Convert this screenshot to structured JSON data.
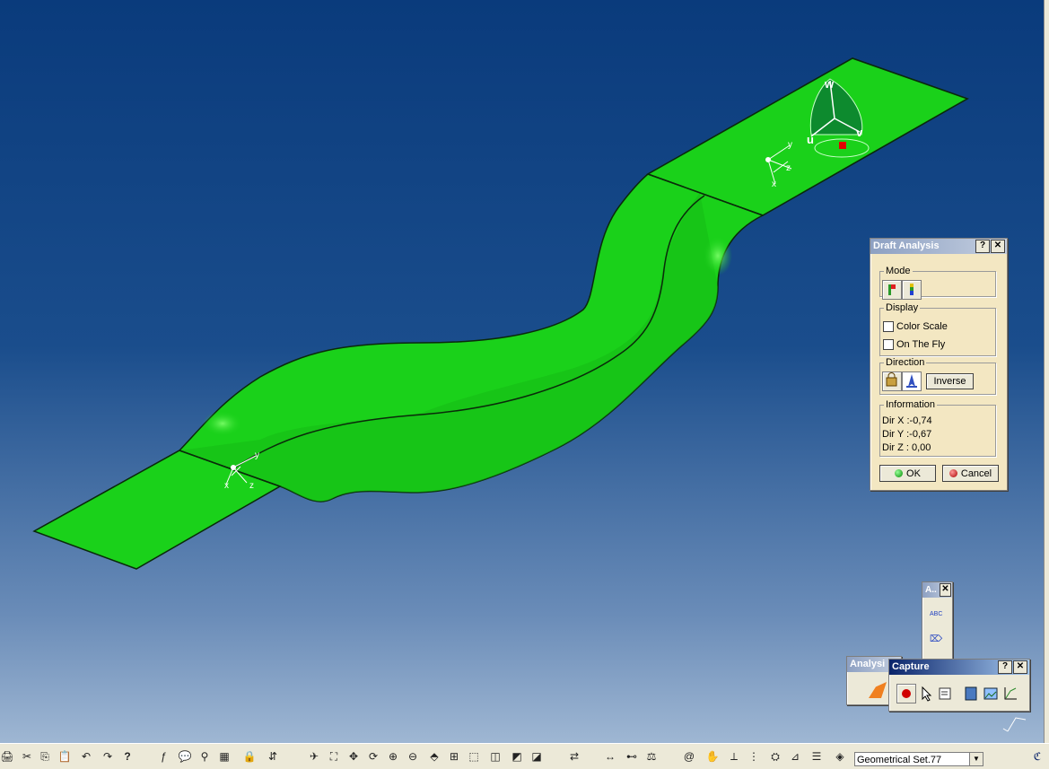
{
  "draft_analysis": {
    "title": "Draft Analysis",
    "help": "?",
    "close": "✕",
    "mode_label": "Mode",
    "display_label": "Display",
    "color_scale_label": "Color Scale",
    "on_the_fly_label": "On The Fly",
    "direction_label": "Direction",
    "inverse_label": "Inverse",
    "information_label": "Information",
    "dir_x": "Dir X :-0,74",
    "dir_y": "Dir Y :-0,67",
    "dir_z": "Dir Z : 0,00",
    "ok_label": "OK",
    "cancel_label": "Cancel"
  },
  "capture_toolbar": {
    "title": "Capture",
    "help": "?",
    "close": "✕"
  },
  "analysis_toolbar": {
    "title": "Analysi"
  },
  "small_toolbar": {
    "title": "A..",
    "close": "✕"
  },
  "compass": {
    "w": "w",
    "u": "u",
    "v": "v"
  },
  "axes_left": {
    "x": "x",
    "y": "y",
    "z": "z"
  },
  "axes_right": {
    "x": "x",
    "y": "y",
    "z": "z"
  },
  "bottom_toolbar": {
    "geometrical_set": "Geometrical Set.77"
  },
  "colors": {
    "surface": "#1ad11a",
    "accent": "#0a246a"
  }
}
